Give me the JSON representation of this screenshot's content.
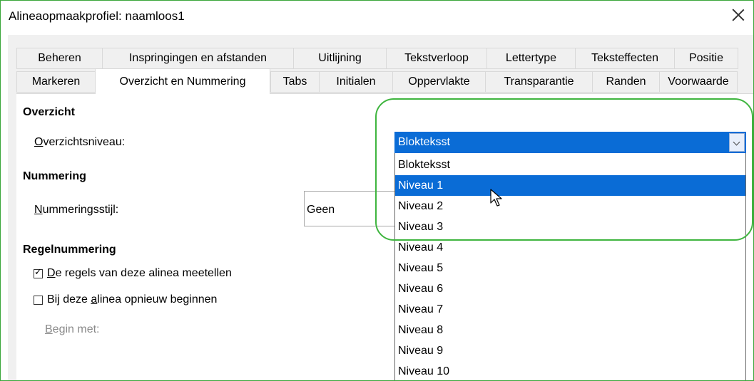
{
  "window": {
    "title": "Alineaopmaakprofiel: naamloos1"
  },
  "tabs_row1": [
    "Beheren",
    "Inspringingen en afstanden",
    "Uitlijning",
    "Tekstverloop",
    "Lettertype",
    "Teksteffecten",
    "Positie"
  ],
  "tabs_row2": [
    "Markeren",
    "Overzicht en Nummering",
    "Tabs",
    "Initialen",
    "Oppervlakte",
    "Transparantie",
    "Randen",
    "Voorwaarde"
  ],
  "overview": {
    "heading": "Overzicht",
    "level_label_u": "O",
    "level_label_rest": "verzichtsniveau:",
    "selected": "Blokteksst"
  },
  "numbering": {
    "heading": "Nummering",
    "style_label_u": "N",
    "style_label_rest": "ummeringsstijl:",
    "style_value": "Geen"
  },
  "line_numbering": {
    "heading": "Regelnummering",
    "count_u": "D",
    "count_rest": "e regels van deze alinea meetellen",
    "count_checked": true,
    "restart_pre": "Bij deze ",
    "restart_u": "a",
    "restart_rest": "linea opnieuw beginnen",
    "restart_checked": false,
    "begin_u": "B",
    "begin_rest": "egin met:"
  },
  "dropdown_options": [
    "Blokteksst",
    "Niveau 1",
    "Niveau 2",
    "Niveau 3",
    "Niveau 4",
    "Niveau 5",
    "Niveau 6",
    "Niveau 7",
    "Niveau 8",
    "Niveau 9",
    "Niveau 10"
  ],
  "highlighted_option_index": 1,
  "colors": {
    "accent": "#0a6cd6",
    "highlight_ring": "#3fb53f"
  }
}
